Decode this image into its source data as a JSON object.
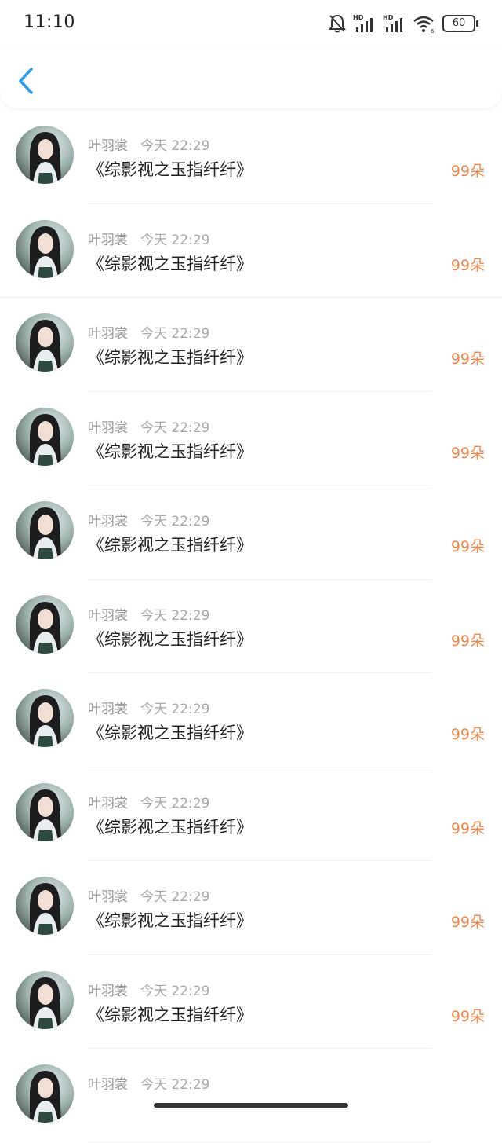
{
  "status_bar": {
    "time": "11:10",
    "hd1": "HD",
    "hd2": "HD",
    "wifi_sub": "6",
    "battery": "60"
  },
  "header": {
    "back_icon": "chevron-left-icon",
    "accent_color": "#2f9ae6"
  },
  "list": {
    "items": [
      {
        "name": "叶羽裳",
        "time": "今天 22:29",
        "title": "《综影视之玉指纤纤》",
        "amount": "99朵"
      },
      {
        "name": "叶羽裳",
        "time": "今天 22:29",
        "title": "《综影视之玉指纤纤》",
        "amount": "99朵"
      },
      {
        "name": "叶羽裳",
        "time": "今天 22:29",
        "title": "《综影视之玉指纤纤》",
        "amount": "99朵"
      },
      {
        "name": "叶羽裳",
        "time": "今天 22:29",
        "title": "《综影视之玉指纤纤》",
        "amount": "99朵"
      },
      {
        "name": "叶羽裳",
        "time": "今天 22:29",
        "title": "《综影视之玉指纤纤》",
        "amount": "99朵"
      },
      {
        "name": "叶羽裳",
        "time": "今天 22:29",
        "title": "《综影视之玉指纤纤》",
        "amount": "99朵"
      },
      {
        "name": "叶羽裳",
        "time": "今天 22:29",
        "title": "《综影视之玉指纤纤》",
        "amount": "99朵"
      },
      {
        "name": "叶羽裳",
        "time": "今天 22:29",
        "title": "《综影视之玉指纤纤》",
        "amount": "99朵"
      },
      {
        "name": "叶羽裳",
        "time": "今天 22:29",
        "title": "《综影视之玉指纤纤》",
        "amount": "99朵"
      },
      {
        "name": "叶羽裳",
        "time": "今天 22:29",
        "title": "《综影视之玉指纤纤》",
        "amount": "99朵"
      },
      {
        "name": "叶羽裳",
        "time": "今天 22:29",
        "title": "",
        "amount": ""
      }
    ]
  },
  "colors": {
    "amount": "#e98a52",
    "meta_text": "#9a9a9a"
  }
}
